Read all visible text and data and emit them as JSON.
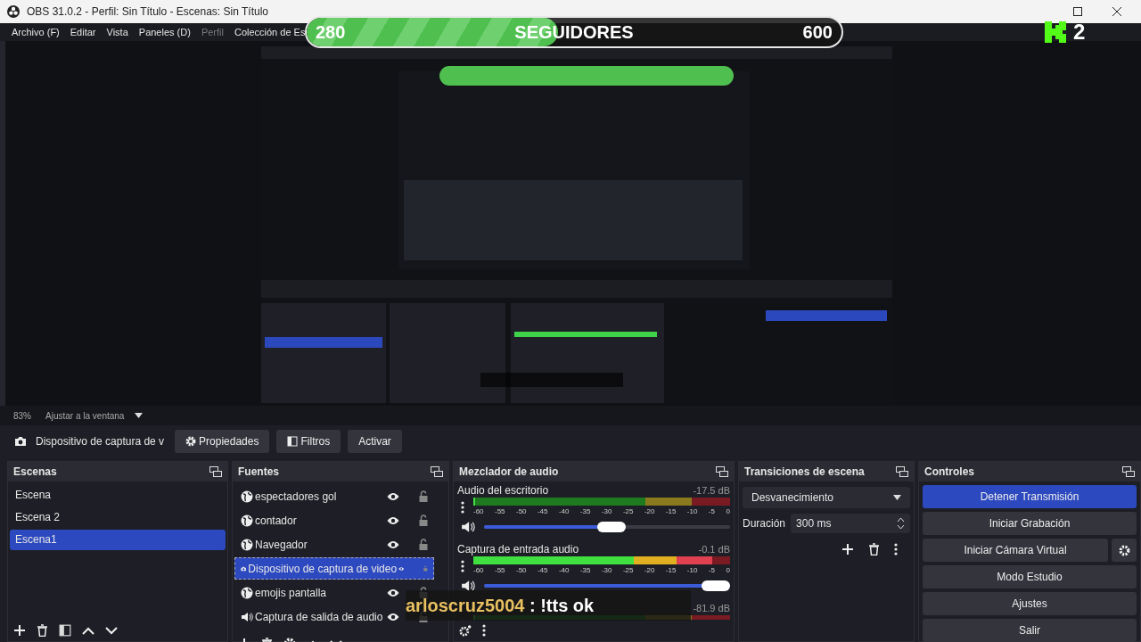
{
  "window": {
    "title": "OBS 31.0.2 - Perfil: Sin Título - Escenas: Sin Título"
  },
  "menu": [
    {
      "label": "Archivo (F)",
      "disabled": false
    },
    {
      "label": "Editar",
      "disabled": false
    },
    {
      "label": "Vista",
      "disabled": false
    },
    {
      "label": "Paneles (D)",
      "disabled": false
    },
    {
      "label": "Perfil",
      "disabled": true
    },
    {
      "label": "Colección de Es",
      "disabled": false
    }
  ],
  "status": {
    "zoom": "83%",
    "fit": "Ajustar a la ventana"
  },
  "toolbar": {
    "source": "Dispositivo de captura de v",
    "buttons": [
      {
        "label": "Propiedades"
      },
      {
        "label": "Filtros"
      },
      {
        "label": "Activar"
      }
    ]
  },
  "scenes": {
    "title": "Escenas",
    "items": [
      {
        "label": "Escena",
        "selected": false
      },
      {
        "label": "Escena 2",
        "selected": false
      },
      {
        "label": "Escena1",
        "selected": true
      }
    ]
  },
  "sources": {
    "title": "Fuentes",
    "items": [
      {
        "label": "espectadores gol",
        "kind": "browser",
        "selected": false
      },
      {
        "label": "contador",
        "kind": "browser",
        "selected": false
      },
      {
        "label": "Navegador",
        "kind": "browser",
        "selected": false
      },
      {
        "label": "Dispositivo de captura de video",
        "kind": "camera",
        "selected": true
      },
      {
        "label": "emojis pantalla",
        "kind": "browser",
        "selected": false
      },
      {
        "label": "Captura de salida de audio",
        "kind": "audio",
        "selected": false
      }
    ]
  },
  "mixer": {
    "title": "Mezclador de audio",
    "channels": [
      {
        "name": "Audio del escritorio",
        "reading": "-17.5 dB",
        "meter": {
          "level": 0
        },
        "ticks": [
          "-60",
          "-55",
          "-50",
          "-45",
          "-40",
          "-35",
          "-30",
          "-25",
          "-20",
          "-15",
          "-10",
          "-5",
          "0"
        ],
        "volume": {
          "level": 0.52
        }
      },
      {
        "name": "Captura de entrada audio",
        "reading": "-0.1 dB",
        "meter": {
          "level": 0.93
        },
        "ticks": [
          "-60",
          "-55",
          "-50",
          "-45",
          "-40",
          "-35",
          "-30",
          "-25",
          "-20",
          "-15",
          "-10",
          "-5",
          "0"
        ],
        "volume": {
          "level": 1
        }
      },
      {
        "reading": "-81.9 dB",
        "meter": {
          "level": 0
        }
      }
    ]
  },
  "transitions": {
    "title": "Transiciones de escena",
    "type": "Desvanecimiento",
    "duration_label": "Duración",
    "duration": "300 ms"
  },
  "controls": {
    "title": "Controles",
    "buttons": [
      {
        "label": "Detener Transmisión",
        "active": true,
        "settings": false
      },
      {
        "label": "Iniciar Grabación",
        "active": false,
        "settings": false
      },
      {
        "label": "Iniciar Cámara Virtual",
        "active": false,
        "settings": true
      },
      {
        "label": "Modo Estudio",
        "active": false,
        "settings": false
      },
      {
        "label": "Ajustes",
        "active": false,
        "settings": false
      },
      {
        "label": "Salir",
        "active": false,
        "settings": false
      }
    ]
  },
  "follower_goal": {
    "current": "280",
    "label": "SEGUIDORES",
    "goal": "600",
    "level": 0.47
  },
  "viewer_badge": {
    "count": "2"
  },
  "chat": {
    "user": "arloscruz5004",
    "message": " : !tts ok"
  }
}
